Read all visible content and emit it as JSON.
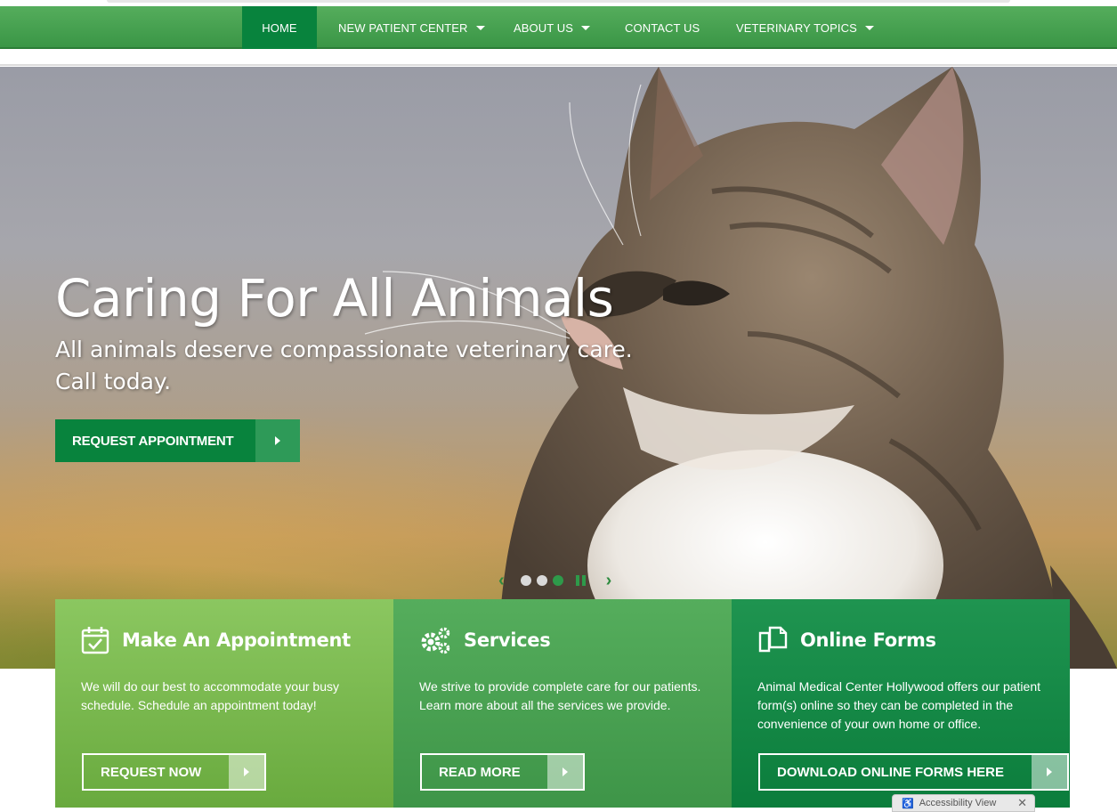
{
  "nav": {
    "items": [
      {
        "label": "HOME",
        "has_dropdown": false,
        "active": true
      },
      {
        "label": "NEW PATIENT CENTER",
        "has_dropdown": true
      },
      {
        "label": "ABOUT US",
        "has_dropdown": true
      },
      {
        "label": "CONTACT US",
        "has_dropdown": false
      },
      {
        "label": "VETERINARY TOPICS",
        "has_dropdown": true
      }
    ]
  },
  "hero": {
    "title": "Caring For All Animals",
    "subtitle": "All animals deserve compassionate veterinary care. Call today.",
    "button_label": "REQUEST APPOINTMENT",
    "slides": 3,
    "active_slide": 3
  },
  "cards": [
    {
      "icon": "calendar-check-icon",
      "title": "Make An Appointment",
      "text": "We will do our best to accommodate your busy schedule. Schedule an appointment today!",
      "button": "REQUEST NOW"
    },
    {
      "icon": "gears-icon",
      "title": "Services",
      "text": "We strive to provide complete care for our patients. Learn more about all the services we provide.",
      "button": "READ MORE"
    },
    {
      "icon": "documents-icon",
      "title": "Online Forms",
      "text": "Animal Medical Center Hollywood offers our patient form(s) online so they can be completed in the convenience of your own home or office.",
      "button": "DOWNLOAD ONLINE FORMS HERE"
    }
  ],
  "accessibility": {
    "label": "Accessibility View",
    "close": "✕"
  },
  "colors": {
    "nav": "#3a9646",
    "active": "#08833d",
    "card1": "#7ab84f",
    "card2": "#4aa152",
    "card3": "#158944"
  }
}
